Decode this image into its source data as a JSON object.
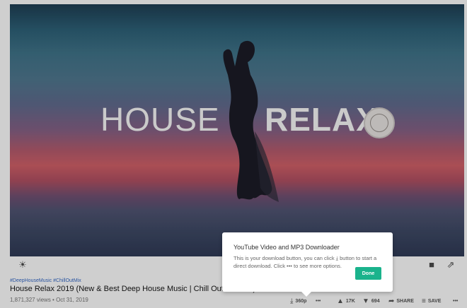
{
  "video": {
    "title_left": "HOUSE",
    "title_right": "RELAX"
  },
  "meta": {
    "hashtags": "#DeepHouseMusic #ChillOutMix",
    "title": "House Relax 2019 (New & Best Deep House Music | Chill Out Mix #25)",
    "views": "1,871,327 views • Oct 31, 2019"
  },
  "actions": {
    "download_quality": "360p",
    "more": "•••",
    "likes": "17K",
    "dislikes": "694",
    "share": "SHARE",
    "save": "SAVE",
    "overflow": "•••"
  },
  "tooltip": {
    "title": "YouTube Video and MP3 Downloader",
    "body_1": "This is your download button, you can click",
    "download_icon": "⤓",
    "body_2": "button to start a direct download. Click",
    "more_icon": "•••",
    "body_3": "to see more options.",
    "done": "Done"
  },
  "icons": {
    "brightness": "☀",
    "camera": "■",
    "share_out": "⇗",
    "download": "⤓",
    "like": "▲",
    "dislike": "▼",
    "share": "➦",
    "save": "≡"
  },
  "colors": {
    "done_button": "#1ab38c",
    "hashtag": "#2a54a0",
    "background_overlay": "#cfcfcf"
  }
}
